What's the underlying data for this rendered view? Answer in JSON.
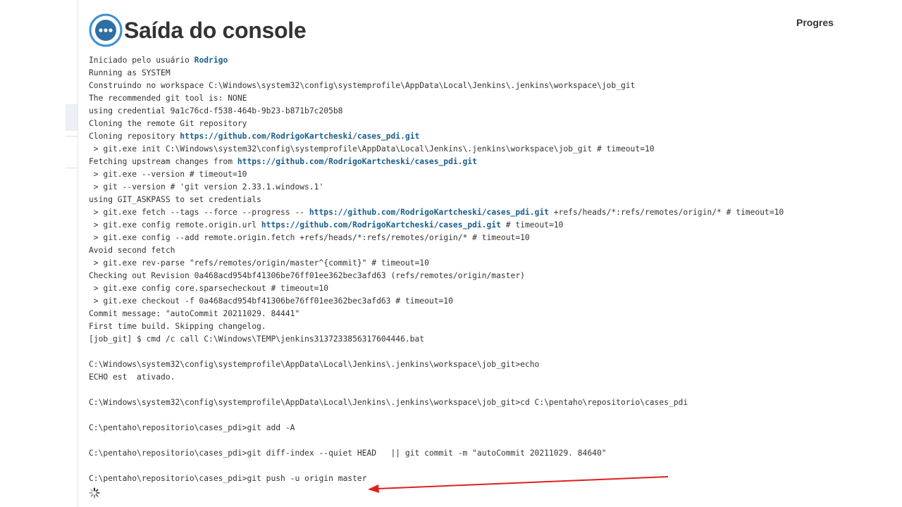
{
  "header": {
    "title": "Saída do console",
    "progress_label": "Progress"
  },
  "colors": {
    "link": "#1a5e8a",
    "icon_blue": "#3b8fd0",
    "arrow_red": "#e02020"
  },
  "icons": {
    "console": "console-output-icon",
    "spinner": "loading-spinner-icon"
  },
  "console": {
    "l1": {
      "text": "Iniciado pelo usuário ",
      "user": "Rodrigo"
    },
    "l2": "Running as SYSTEM",
    "l3": "Construindo no workspace C:\\Windows\\system32\\config\\systemprofile\\AppData\\Local\\Jenkins\\.jenkins\\workspace\\job_git",
    "l4": "The recommended git tool is: NONE",
    "l5": "using credential 9a1c76cd-f538-464b-9b23-b871b7c205b8",
    "l6": "Cloning the remote Git repository",
    "l7": {
      "text": "Cloning repository ",
      "url": "https://github.com/RodrigoKartcheski/cases_pdi.git"
    },
    "l8": " > git.exe init C:\\Windows\\system32\\config\\systemprofile\\AppData\\Local\\Jenkins\\.jenkins\\workspace\\job_git # timeout=10",
    "l9": {
      "text": "Fetching upstream changes from ",
      "url": "https://github.com/RodrigoKartcheski/cases_pdi.git"
    },
    "l10": " > git.exe --version # timeout=10",
    "l11": " > git --version # 'git version 2.33.1.windows.1'",
    "l12": "using GIT_ASKPASS to set credentials",
    "l13": {
      "pre": " > git.exe fetch --tags --force --progress -- ",
      "url": "https://github.com/RodrigoKartcheski/cases_pdi.git",
      "post": " +refs/heads/*:refs/remotes/origin/* # timeout=10"
    },
    "l14": {
      "pre": " > git.exe config remote.origin.url ",
      "url": "https://github.com/RodrigoKartcheski/cases_pdi.git",
      "post": " # timeout=10"
    },
    "l15": " > git.exe config --add remote.origin.fetch +refs/heads/*:refs/remotes/origin/* # timeout=10",
    "l16": "Avoid second fetch",
    "l17": " > git.exe rev-parse \"refs/remotes/origin/master^{commit}\" # timeout=10",
    "l18": "Checking out Revision 0a468acd954bf41306be76ff01ee362bec3afd63 (refs/remotes/origin/master)",
    "l19": " > git.exe config core.sparsecheckout # timeout=10",
    "l20": " > git.exe checkout -f 0a468acd954bf41306be76ff01ee362bec3afd63 # timeout=10",
    "l21": "Commit message: \"autoCommit 20211029. 84441\"",
    "l22": "First time build. Skipping changelog.",
    "l23": "[job_git] $ cmd /c call C:\\Windows\\TEMP\\jenkins3137233856317604446.bat",
    "l24": "",
    "l25": "C:\\Windows\\system32\\config\\systemprofile\\AppData\\Local\\Jenkins\\.jenkins\\workspace\\job_git>echo",
    "l26": "ECHO est  ativado.",
    "l27": "",
    "l28": "C:\\Windows\\system32\\config\\systemprofile\\AppData\\Local\\Jenkins\\.jenkins\\workspace\\job_git>cd C:\\pentaho\\repositorio\\cases_pdi",
    "l29": "",
    "l30": "C:\\pentaho\\repositorio\\cases_pdi>git add -A",
    "l31": "",
    "l32": "C:\\pentaho\\repositorio\\cases_pdi>git diff-index --quiet HEAD   || git commit -m \"autoCommit 20211029. 84640\"",
    "l33": "",
    "l34": "C:\\pentaho\\repositorio\\cases_pdi>git push -u origin master"
  }
}
